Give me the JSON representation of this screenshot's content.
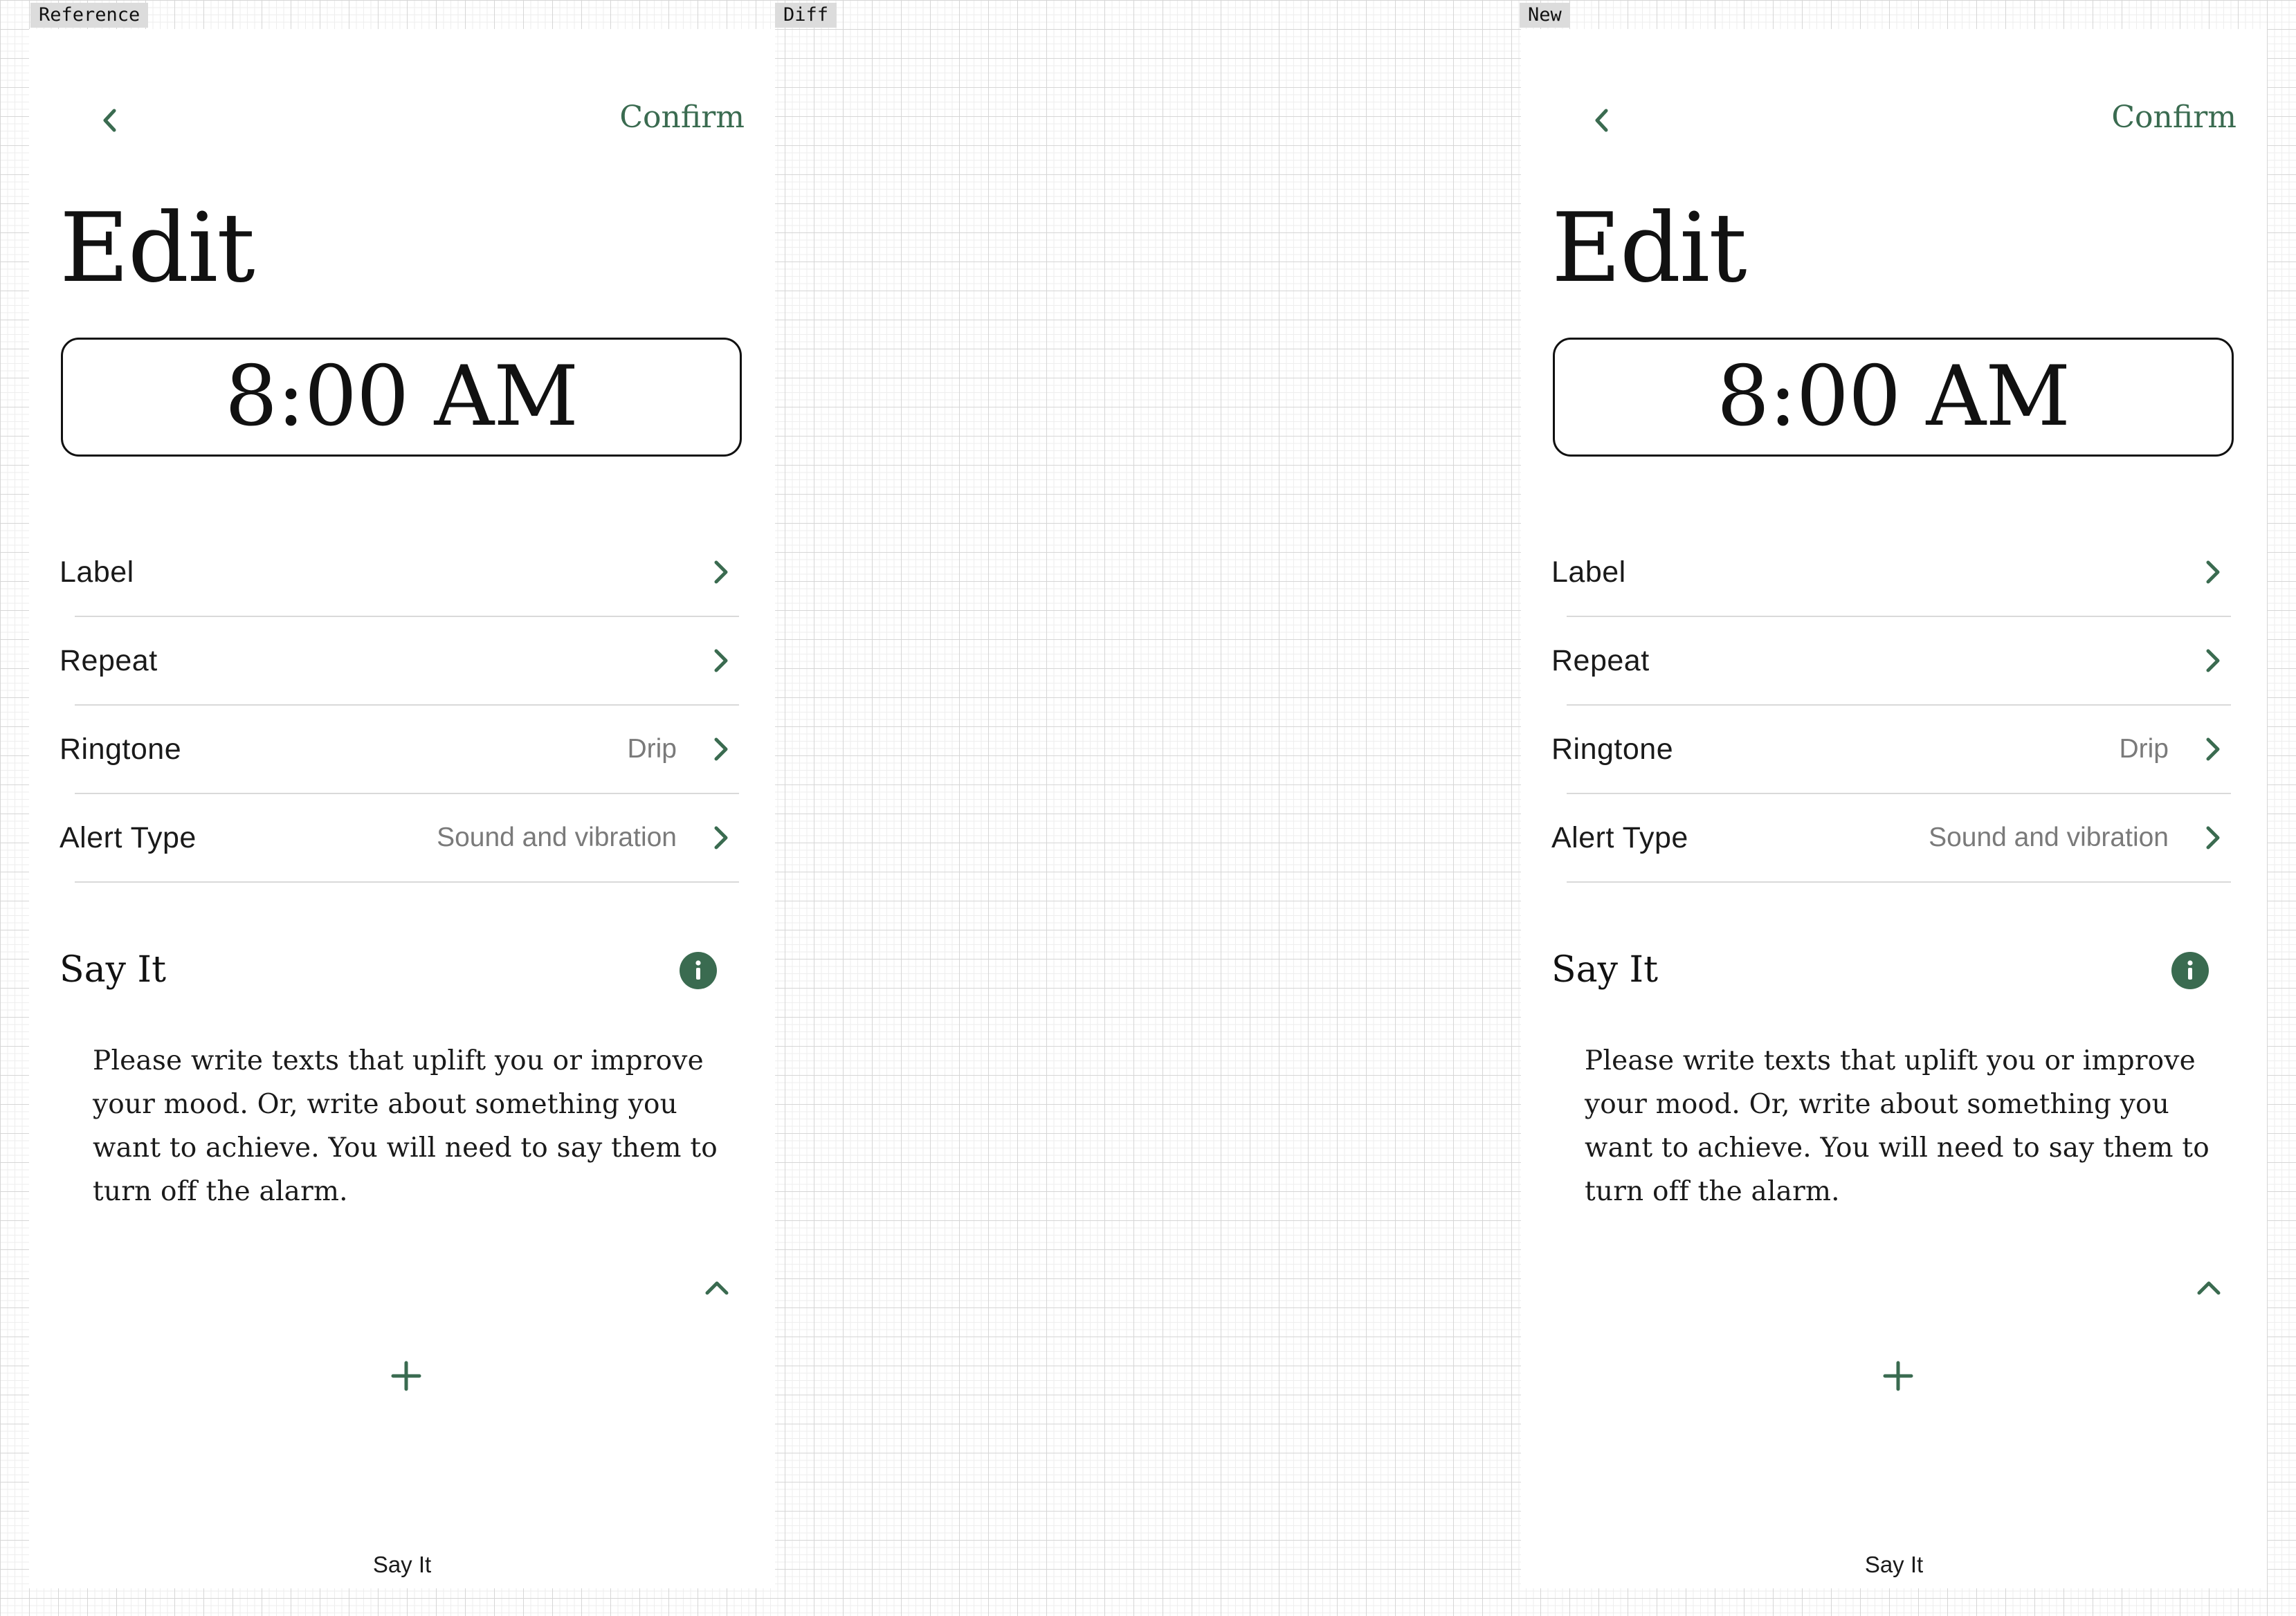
{
  "panels": {
    "reference_label": "Reference",
    "diff_label": "Diff",
    "new_label": "New"
  },
  "screens": [
    {
      "header": {
        "confirm_label": "Confirm",
        "back_icon": "chevron-left-icon"
      },
      "title": "Edit",
      "time": "8:00 AM",
      "settings": [
        {
          "label": "Label",
          "value": ""
        },
        {
          "label": "Repeat",
          "value": ""
        },
        {
          "label": "Ringtone",
          "value": "Drip"
        },
        {
          "label": "Alert Type",
          "value": "Sound and vibration"
        }
      ],
      "say_it": {
        "heading": "Say It",
        "info_icon": "info-icon",
        "description": "Please write texts that uplift you or improve your mood. Or, write about something you want to achieve. You will need to say them to turn off the alarm.",
        "collapse_icon": "chevron-up-icon",
        "add_icon": "plus-icon"
      },
      "bottom_label": "Say It"
    },
    {
      "header": {
        "confirm_label": "Confirm",
        "back_icon": "chevron-left-icon"
      },
      "title": "Edit",
      "time": "8:00 AM",
      "settings": [
        {
          "label": "Label",
          "value": ""
        },
        {
          "label": "Repeat",
          "value": ""
        },
        {
          "label": "Ringtone",
          "value": "Drip"
        },
        {
          "label": "Alert Type",
          "value": "Sound and vibration"
        }
      ],
      "say_it": {
        "heading": "Say It",
        "info_icon": "info-icon",
        "description": "Please write texts that uplift you or improve your mood. Or, write about something you want to achieve. You will need to say them to turn off the alarm.",
        "collapse_icon": "chevron-up-icon",
        "add_icon": "plus-icon"
      },
      "bottom_label": "Say It"
    }
  ],
  "colors": {
    "accent": "#3a6b50",
    "text": "#111111",
    "muted": "#7a7a7a",
    "divider": "#d9d9d9",
    "tag_background": "#dcdcdc"
  }
}
